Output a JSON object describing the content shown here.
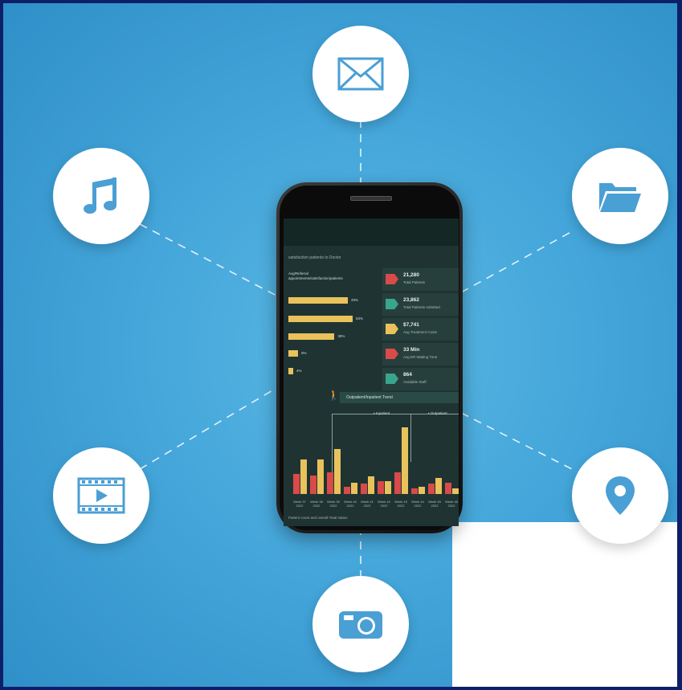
{
  "dashboard": {
    "subtitle": "satisfaction patients to Doctor",
    "legend_line1": "Avg/Referral",
    "legend_line2": "appointments/satisfaction/patients",
    "bars": [
      {
        "label": "49%",
        "value": 49
      },
      {
        "label": "53%",
        "value": 53
      },
      {
        "label": "38%",
        "value": 38
      },
      {
        "label": "8%",
        "value": 8
      },
      {
        "label": "4%",
        "value": 4
      }
    ],
    "kpis": [
      {
        "value": "21,280",
        "label": "Total Patients",
        "color": "#d94a4a"
      },
      {
        "value": "23,862",
        "label": "Total Patients Admitted",
        "color": "#3aa58d"
      },
      {
        "value": "$7,741",
        "label": "Avg Treatment Costs",
        "color": "#e9c25c"
      },
      {
        "value": "33 Min",
        "label": "Avg ER Waiting Time",
        "color": "#d94a4a"
      },
      {
        "value": "864",
        "label": "Available Staff",
        "color": "#3aa58d"
      }
    ],
    "trend_title": "Outpatient/Inpatient Trend",
    "legend_inpatient": "• Inpatient",
    "legend_outpatient": "• Outpatient",
    "bar_colors": {
      "inpatient": "#d94a4a",
      "outpatient": "#e9c25c"
    },
    "periods": [
      {
        "x": "Week 37 2022",
        "inpatient": 14,
        "outpatient": 24
      },
      {
        "x": "Week 38 2022",
        "inpatient": 13,
        "outpatient": 24
      },
      {
        "x": "Week 39 2022",
        "inpatient": 15,
        "outpatient": 31
      },
      {
        "x": "Week 40 2022",
        "inpatient": 5,
        "outpatient": 8
      },
      {
        "x": "Week 41 2022",
        "inpatient": 7,
        "outpatient": 12
      },
      {
        "x": "Week 42 2022",
        "inpatient": 9,
        "outpatient": 9
      },
      {
        "x": "Week 43 2022",
        "inpatient": 15,
        "outpatient": 46
      },
      {
        "x": "Week 44 2022",
        "inpatient": 4,
        "outpatient": 5
      },
      {
        "x": "Week 45 2022",
        "inpatient": 7,
        "outpatient": 11
      },
      {
        "x": "Week 46 2022",
        "inpatient": 8,
        "outpatient": 4
      }
    ],
    "footnote": "Patient count and overall Total status"
  },
  "icons": {
    "top": "mail-icon",
    "top_left": "music-note-icon",
    "top_right": "folder-icon",
    "bottom_left": "video-icon",
    "bottom_right": "map-pin-icon",
    "bottom": "camera-icon"
  },
  "colors": {
    "icon": "#4a9fd4",
    "background": "#44a6da",
    "frame": "#0d1f66"
  }
}
